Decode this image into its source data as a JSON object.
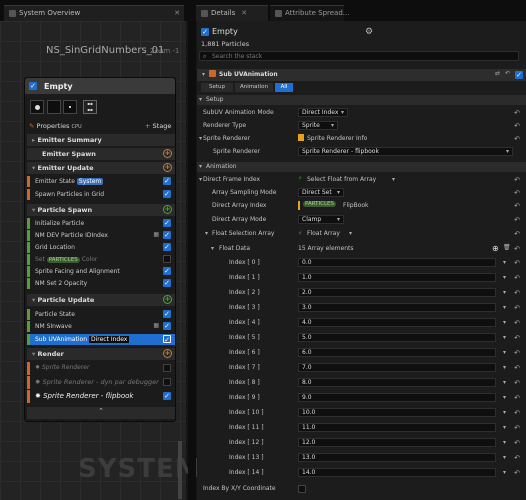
{
  "tabs": [
    {
      "label": "System Overview"
    },
    {
      "label": "Details"
    },
    {
      "label": "Attribute Spread..."
    }
  ],
  "graph": {
    "title": "NS_SinGridNumbers_01",
    "zoom": "Zoom -1",
    "watermark": "SYSTEM"
  },
  "emitter": {
    "title": "Empty",
    "properties": "Properties",
    "cpu": "CPU",
    "stage": "Stage",
    "summary": "Emitter Summary",
    "spawn": "Emitter Spawn",
    "update": "Emitter Update",
    "emitter_update_items": [
      {
        "label": "Emitter State",
        "tag": "System"
      },
      {
        "label": "Spawn Particles in Grid"
      }
    ],
    "particle_spawn": "Particle Spawn",
    "particle_spawn_items": [
      "Initialize Particle",
      "NM DEV Particle IDIndex",
      "Grid Location",
      "Set",
      "Sprite Facing and Alignment",
      "NM Set 2 Opacity"
    ],
    "set_tag": "PARTICLES",
    "set_suffix": "Color",
    "particle_update": "Particle Update",
    "particle_update_items": [
      "Particle State",
      "NM SInwave",
      "Sub UVAnimation"
    ],
    "subuv_tag": "Direct Index",
    "render": "Render",
    "render_items": [
      "Sprite Renderer",
      "Sprite Renderer - dyn par debugger",
      "Sprite Renderer - flipbook"
    ]
  },
  "details": {
    "name": "Empty",
    "particles": "1,881 Particles",
    "search_placeholder": "Search the stack",
    "module": "Sub UVAnimation",
    "filters": [
      "Setup",
      "Animation",
      "All"
    ],
    "setup": "Setup",
    "subuv_mode_label": "SubUV Animation Mode",
    "subuv_mode": "Direct Index",
    "renderer_type_label": "Renderer Type",
    "renderer_type": "Sprite",
    "sprite_renderer_label": "Sprite Renderer",
    "sprite_renderer_info": "Sprite Renderer Info",
    "sprite_renderer_sub_label": "Sprite Renderer",
    "sprite_renderer_value": "Sprite Renderer - flipbook",
    "animation": "Animation",
    "direct_frame_label": "Direct Frame Index",
    "direct_frame_value": "Select Float from Array",
    "array_sampling_label": "Array Sampling Mode",
    "array_sampling_value": "Direct Set",
    "array_index_label": "Direct Array Index",
    "array_index_tag": "PARTICLES",
    "array_index_value": "FlipBook",
    "array_mode_label": "Direct Array Mode",
    "array_mode_value": "Clamp",
    "float_sel_label": "Float Selection Array",
    "float_sel_value": "Float Array",
    "float_data_label": "Float Data",
    "float_data_count": "15 Array elements",
    "indices": [
      {
        "label": "Index [ 0 ]",
        "value": "0.0"
      },
      {
        "label": "Index [ 1 ]",
        "value": "1.0"
      },
      {
        "label": "Index [ 2 ]",
        "value": "2.0"
      },
      {
        "label": "Index [ 3 ]",
        "value": "3.0"
      },
      {
        "label": "Index [ 4 ]",
        "value": "4.0"
      },
      {
        "label": "Index [ 5 ]",
        "value": "5.0"
      },
      {
        "label": "Index [ 6 ]",
        "value": "6.0"
      },
      {
        "label": "Index [ 7 ]",
        "value": "7.0"
      },
      {
        "label": "Index [ 8 ]",
        "value": "8.0"
      },
      {
        "label": "Index [ 9 ]",
        "value": "9.0"
      },
      {
        "label": "Index [ 10 ]",
        "value": "10.0"
      },
      {
        "label": "Index [ 11 ]",
        "value": "11.0"
      },
      {
        "label": "Index [ 12 ]",
        "value": "12.0"
      },
      {
        "label": "Index [ 13 ]",
        "value": "13.0"
      },
      {
        "label": "Index [ 14 ]",
        "value": "14.0"
      }
    ],
    "index_by_xy": "Index By X/Y Coordinate"
  },
  "colors": {
    "accent": "#1f6fd1",
    "orange": "#c9682e",
    "green": "#5a9b3e"
  }
}
